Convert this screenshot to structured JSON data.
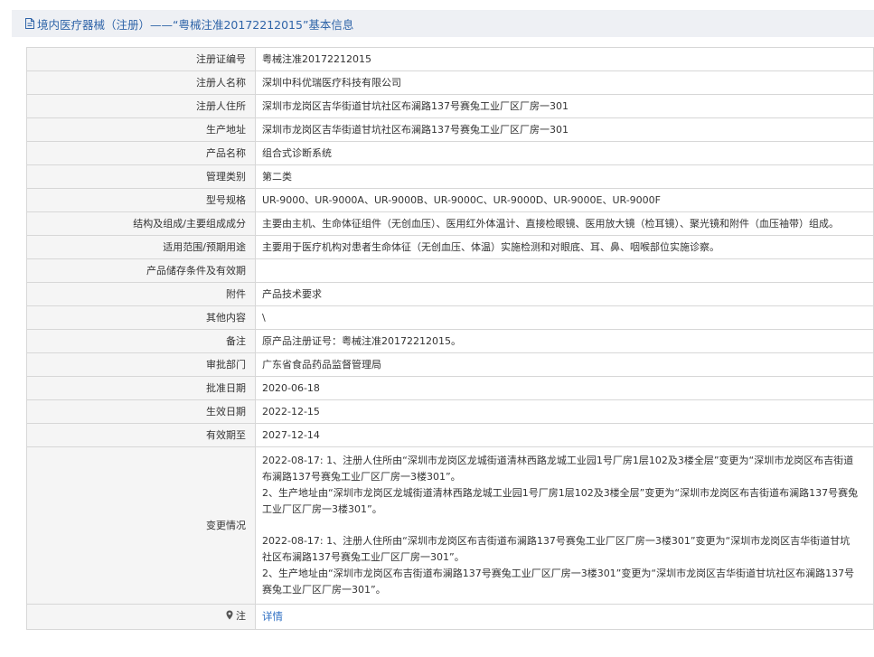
{
  "header": {
    "title": "境内医疗器械（注册）——“粤械注准20172212015”基本信息",
    "icon": "document-icon"
  },
  "rows": [
    {
      "label": "注册证编号",
      "value": "粤械注准20172212015"
    },
    {
      "label": "注册人名称",
      "value": "深圳中科优瑞医疗科技有限公司"
    },
    {
      "label": "注册人住所",
      "value": "深圳市龙岗区吉华街道甘坑社区布澜路137号赛兔工业厂区厂房一301"
    },
    {
      "label": "生产地址",
      "value": "深圳市龙岗区吉华街道甘坑社区布澜路137号赛兔工业厂区厂房一301"
    },
    {
      "label": "产品名称",
      "value": "组合式诊断系统"
    },
    {
      "label": "管理类别",
      "value": "第二类"
    },
    {
      "label": "型号规格",
      "value": "UR-9000、UR-9000A、UR-9000B、UR-9000C、UR-9000D、UR-9000E、UR-9000F"
    },
    {
      "label": "结构及组成/主要组成成分",
      "value": "主要由主机、生命体征组件（无创血压）、医用红外体温计、直接检眼镜、医用放大镜（检耳镜）、聚光镜和附件（血压袖带）组成。"
    },
    {
      "label": "适用范围/预期用途",
      "value": "主要用于医疗机构对患者生命体征（无创血压、体温）实施检测和对眼底、耳、鼻、咽喉部位实施诊察。"
    },
    {
      "label": "产品储存条件及有效期",
      "value": ""
    },
    {
      "label": "附件",
      "value": "产品技术要求"
    },
    {
      "label": "其他内容",
      "value": "\\"
    },
    {
      "label": "备注",
      "value": "原产品注册证号：粤械注准20172212015。"
    },
    {
      "label": "审批部门",
      "value": "广东省食品药品监督管理局"
    },
    {
      "label": "批准日期",
      "value": "2020-06-18"
    },
    {
      "label": "生效日期",
      "value": "2022-12-15"
    },
    {
      "label": "有效期至",
      "value": "2027-12-14"
    }
  ],
  "change": {
    "label": "变更情况",
    "block1": [
      "2022-08-17: 1、注册人住所由“深圳市龙岗区龙城街道清林西路龙城工业园1号厂房1层102及3楼全层”变更为“深圳市龙岗区布吉街道布澜路137号赛兔工业厂区厂房一3楼301”。",
      "2、生产地址由“深圳市龙岗区龙城街道清林西路龙城工业园1号厂房1层102及3楼全层”变更为“深圳市龙岗区布吉街道布澜路137号赛兔工业厂区厂房一3楼301”。"
    ],
    "block2": [
      "2022-08-17: 1、注册人住所由“深圳市龙岗区布吉街道布澜路137号赛兔工业厂区厂房一3楼301”变更为“深圳市龙岗区吉华街道甘坑社区布澜路137号赛兔工业厂区厂房一301”。",
      "2、生产地址由“深圳市龙岗区布吉街道布澜路137号赛兔工业厂区厂房一3楼301”变更为“深圳市龙岗区吉华街道甘坑社区布澜路137号赛兔工业厂区厂房一301”。"
    ]
  },
  "note": {
    "label": "注",
    "icon": "map-pin-icon",
    "link_text": "详情"
  }
}
